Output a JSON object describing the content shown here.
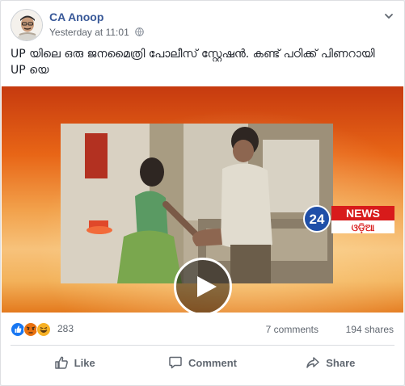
{
  "post": {
    "author": "CA Anoop",
    "timestamp": "Yesterday at 11:01",
    "privacy_icon": "globe-icon",
    "text": "UP യിലെ ഒരു ജനമൈത്രി പോലീസ് സ്റ്റേഷൻ. കണ്ട് പഠിക്ക് പിണറായി UP യെ"
  },
  "video": {
    "channel_number": "24",
    "channel_name": "NEWS",
    "channel_region": "ଓଡ଼ିଆ",
    "play_icon": "play-icon"
  },
  "stats": {
    "reaction_icons": [
      "like-icon",
      "angry-icon",
      "haha-icon"
    ],
    "reaction_count": "283",
    "comments": "7 comments",
    "shares": "194 shares"
  },
  "actions": {
    "like": "Like",
    "comment": "Comment",
    "share": "Share"
  },
  "colors": {
    "author_link": "#385898",
    "meta_text": "#616770",
    "like_blue": "#1877f2",
    "angry_red": "#e9710f",
    "haha_yellow": "#f7b125",
    "news_red": "#d81b1b",
    "news_blue": "#1f4fa8"
  }
}
